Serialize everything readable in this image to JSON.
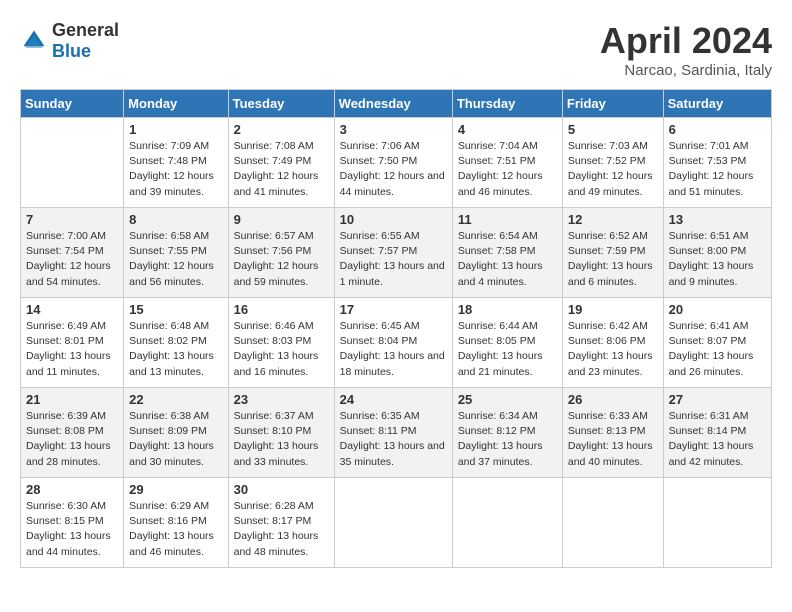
{
  "header": {
    "logo_general": "General",
    "logo_blue": "Blue",
    "month": "April 2024",
    "location": "Narcao, Sardinia, Italy"
  },
  "weekdays": [
    "Sunday",
    "Monday",
    "Tuesday",
    "Wednesday",
    "Thursday",
    "Friday",
    "Saturday"
  ],
  "weeks": [
    [
      {
        "day": null
      },
      {
        "day": "1",
        "sunrise": "Sunrise: 7:09 AM",
        "sunset": "Sunset: 7:48 PM",
        "daylight": "Daylight: 12 hours and 39 minutes."
      },
      {
        "day": "2",
        "sunrise": "Sunrise: 7:08 AM",
        "sunset": "Sunset: 7:49 PM",
        "daylight": "Daylight: 12 hours and 41 minutes."
      },
      {
        "day": "3",
        "sunrise": "Sunrise: 7:06 AM",
        "sunset": "Sunset: 7:50 PM",
        "daylight": "Daylight: 12 hours and 44 minutes."
      },
      {
        "day": "4",
        "sunrise": "Sunrise: 7:04 AM",
        "sunset": "Sunset: 7:51 PM",
        "daylight": "Daylight: 12 hours and 46 minutes."
      },
      {
        "day": "5",
        "sunrise": "Sunrise: 7:03 AM",
        "sunset": "Sunset: 7:52 PM",
        "daylight": "Daylight: 12 hours and 49 minutes."
      },
      {
        "day": "6",
        "sunrise": "Sunrise: 7:01 AM",
        "sunset": "Sunset: 7:53 PM",
        "daylight": "Daylight: 12 hours and 51 minutes."
      }
    ],
    [
      {
        "day": "7",
        "sunrise": "Sunrise: 7:00 AM",
        "sunset": "Sunset: 7:54 PM",
        "daylight": "Daylight: 12 hours and 54 minutes."
      },
      {
        "day": "8",
        "sunrise": "Sunrise: 6:58 AM",
        "sunset": "Sunset: 7:55 PM",
        "daylight": "Daylight: 12 hours and 56 minutes."
      },
      {
        "day": "9",
        "sunrise": "Sunrise: 6:57 AM",
        "sunset": "Sunset: 7:56 PM",
        "daylight": "Daylight: 12 hours and 59 minutes."
      },
      {
        "day": "10",
        "sunrise": "Sunrise: 6:55 AM",
        "sunset": "Sunset: 7:57 PM",
        "daylight": "Daylight: 13 hours and 1 minute."
      },
      {
        "day": "11",
        "sunrise": "Sunrise: 6:54 AM",
        "sunset": "Sunset: 7:58 PM",
        "daylight": "Daylight: 13 hours and 4 minutes."
      },
      {
        "day": "12",
        "sunrise": "Sunrise: 6:52 AM",
        "sunset": "Sunset: 7:59 PM",
        "daylight": "Daylight: 13 hours and 6 minutes."
      },
      {
        "day": "13",
        "sunrise": "Sunrise: 6:51 AM",
        "sunset": "Sunset: 8:00 PM",
        "daylight": "Daylight: 13 hours and 9 minutes."
      }
    ],
    [
      {
        "day": "14",
        "sunrise": "Sunrise: 6:49 AM",
        "sunset": "Sunset: 8:01 PM",
        "daylight": "Daylight: 13 hours and 11 minutes."
      },
      {
        "day": "15",
        "sunrise": "Sunrise: 6:48 AM",
        "sunset": "Sunset: 8:02 PM",
        "daylight": "Daylight: 13 hours and 13 minutes."
      },
      {
        "day": "16",
        "sunrise": "Sunrise: 6:46 AM",
        "sunset": "Sunset: 8:03 PM",
        "daylight": "Daylight: 13 hours and 16 minutes."
      },
      {
        "day": "17",
        "sunrise": "Sunrise: 6:45 AM",
        "sunset": "Sunset: 8:04 PM",
        "daylight": "Daylight: 13 hours and 18 minutes."
      },
      {
        "day": "18",
        "sunrise": "Sunrise: 6:44 AM",
        "sunset": "Sunset: 8:05 PM",
        "daylight": "Daylight: 13 hours and 21 minutes."
      },
      {
        "day": "19",
        "sunrise": "Sunrise: 6:42 AM",
        "sunset": "Sunset: 8:06 PM",
        "daylight": "Daylight: 13 hours and 23 minutes."
      },
      {
        "day": "20",
        "sunrise": "Sunrise: 6:41 AM",
        "sunset": "Sunset: 8:07 PM",
        "daylight": "Daylight: 13 hours and 26 minutes."
      }
    ],
    [
      {
        "day": "21",
        "sunrise": "Sunrise: 6:39 AM",
        "sunset": "Sunset: 8:08 PM",
        "daylight": "Daylight: 13 hours and 28 minutes."
      },
      {
        "day": "22",
        "sunrise": "Sunrise: 6:38 AM",
        "sunset": "Sunset: 8:09 PM",
        "daylight": "Daylight: 13 hours and 30 minutes."
      },
      {
        "day": "23",
        "sunrise": "Sunrise: 6:37 AM",
        "sunset": "Sunset: 8:10 PM",
        "daylight": "Daylight: 13 hours and 33 minutes."
      },
      {
        "day": "24",
        "sunrise": "Sunrise: 6:35 AM",
        "sunset": "Sunset: 8:11 PM",
        "daylight": "Daylight: 13 hours and 35 minutes."
      },
      {
        "day": "25",
        "sunrise": "Sunrise: 6:34 AM",
        "sunset": "Sunset: 8:12 PM",
        "daylight": "Daylight: 13 hours and 37 minutes."
      },
      {
        "day": "26",
        "sunrise": "Sunrise: 6:33 AM",
        "sunset": "Sunset: 8:13 PM",
        "daylight": "Daylight: 13 hours and 40 minutes."
      },
      {
        "day": "27",
        "sunrise": "Sunrise: 6:31 AM",
        "sunset": "Sunset: 8:14 PM",
        "daylight": "Daylight: 13 hours and 42 minutes."
      }
    ],
    [
      {
        "day": "28",
        "sunrise": "Sunrise: 6:30 AM",
        "sunset": "Sunset: 8:15 PM",
        "daylight": "Daylight: 13 hours and 44 minutes."
      },
      {
        "day": "29",
        "sunrise": "Sunrise: 6:29 AM",
        "sunset": "Sunset: 8:16 PM",
        "daylight": "Daylight: 13 hours and 46 minutes."
      },
      {
        "day": "30",
        "sunrise": "Sunrise: 6:28 AM",
        "sunset": "Sunset: 8:17 PM",
        "daylight": "Daylight: 13 hours and 48 minutes."
      },
      {
        "day": null
      },
      {
        "day": null
      },
      {
        "day": null
      },
      {
        "day": null
      }
    ]
  ]
}
